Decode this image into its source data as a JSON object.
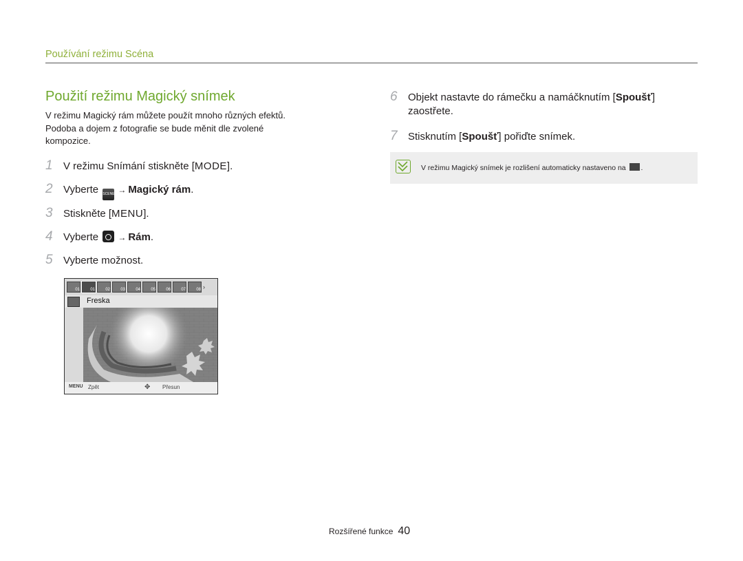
{
  "header": {
    "section": "Používání režimu Scéna"
  },
  "left": {
    "title": "Použití režimu Magický snímek",
    "intro_line1": "V režimu Magický rám můžete použít mnoho různých efektů.",
    "intro_line2": "Podoba a dojem z fotografie se bude měnit dle zvolené",
    "intro_line3": "kompozice.",
    "steps": [
      {
        "num": "1",
        "pre": "V režimu Snímání stiskněte [",
        "key": "MODE",
        "post": "]."
      },
      {
        "num": "2",
        "pre": "Vyberte",
        "icon": "scene-icon",
        "icon_text": "SCENE",
        "arrow": "→",
        "bold": "Magický rám",
        "post": "."
      },
      {
        "num": "3",
        "pre": "Stiskněte [",
        "key": "MENU",
        "post": "]."
      },
      {
        "num": "4",
        "pre": "Vyberte",
        "icon": "camera-icon",
        "arrow": "→",
        "bold": "Rám",
        "post": "."
      },
      {
        "num": "5",
        "pre": "Vyberte možnost."
      }
    ]
  },
  "screen": {
    "frame_labels": [
      "01",
      "01",
      "02",
      "03",
      "04",
      "05",
      "06",
      "07",
      "08"
    ],
    "selected_frame": "01",
    "frame_name": "Freska",
    "bottom_left_key": "MENU",
    "bottom_left": "Zpět",
    "bottom_right": "Přesun"
  },
  "right": {
    "steps": [
      {
        "num": "6",
        "pre": "Objekt nastavte do rámečku a namáčknutím [",
        "bold": "Spoušť",
        "post": "]",
        "line2": "zaostřete."
      },
      {
        "num": "7",
        "pre": "Stisknutím [",
        "bold": "Spoušť",
        "post": "] pořiďte snímek."
      }
    ],
    "note": "V režimu Magický snímek je rozlišení automaticky nastaveno na",
    "note_end": "."
  },
  "footer": {
    "label": "Rozšířené funkce",
    "page": "40"
  },
  "colors": {
    "accent": "#6fa82e",
    "section": "#8fb03a",
    "step_num": "#a7a9ac"
  }
}
